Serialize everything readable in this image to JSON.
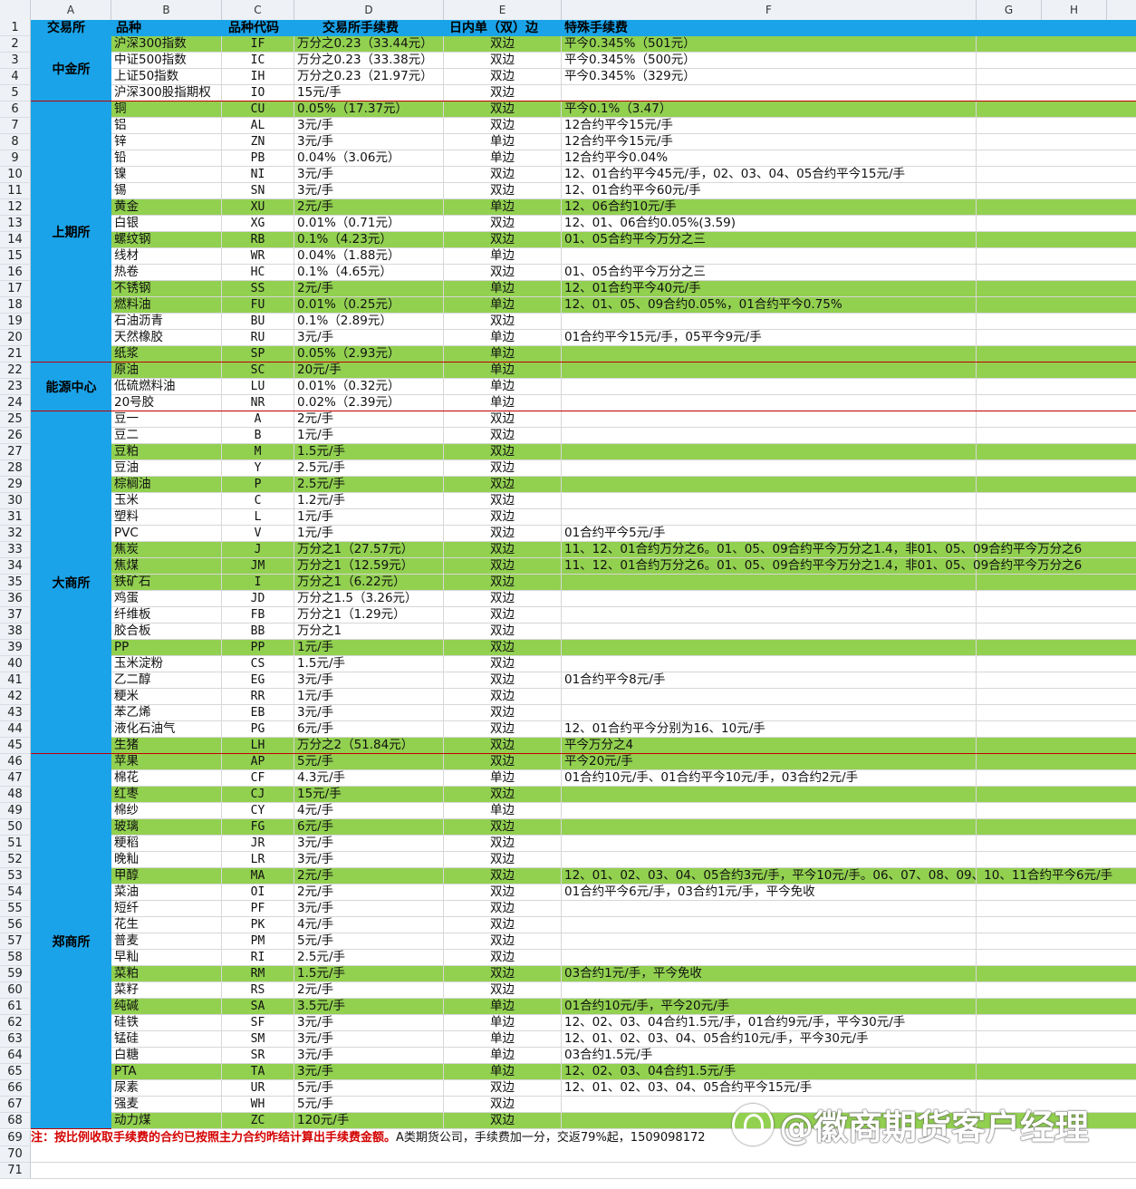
{
  "col_headers": [
    "A",
    "B",
    "C",
    "D",
    "E",
    "F",
    "G",
    "H"
  ],
  "header": {
    "exchange": "交易所",
    "variety": "品种",
    "code": "品种代码",
    "fee": "交易所手续费",
    "intraday": "日内单（双）边",
    "special": "特殊手续费"
  },
  "exchanges": [
    {
      "name": "中金所",
      "first_row": 2,
      "last_row": 5
    },
    {
      "name": "上期所",
      "first_row": 6,
      "last_row": 21
    },
    {
      "name": "能源中心",
      "first_row": 22,
      "last_row": 24
    },
    {
      "name": "大商所",
      "first_row": 25,
      "last_row": 45
    },
    {
      "name": "郑商所",
      "first_row": 46,
      "last_row": 68
    }
  ],
  "rows": [
    {
      "n": 2,
      "green": true,
      "name": "沪深300指数",
      "code": "IF",
      "fee": "万分之0.23（33.44元）",
      "side": "双边",
      "special": "平今0.345%（501元）"
    },
    {
      "n": 3,
      "green": false,
      "name": "中证500指数",
      "code": "IC",
      "fee": "万分之0.23（33.38元）",
      "side": "双边",
      "special": "平今0.345%（500元）"
    },
    {
      "n": 4,
      "green": false,
      "name": "上证50指数",
      "code": "IH",
      "fee": "万分之0.23（21.97元）",
      "side": "双边",
      "special": "平今0.345%（329元）"
    },
    {
      "n": 5,
      "green": false,
      "name": "沪深300股指期权",
      "code": "IO",
      "fee": "15元/手",
      "side": "双边",
      "special": ""
    },
    {
      "n": 6,
      "green": true,
      "name": "铜",
      "code": "CU",
      "fee": "0.05%（17.37元）",
      "side": "双边",
      "special": "平今0.1%（3.47）"
    },
    {
      "n": 7,
      "green": false,
      "name": "铝",
      "code": "AL",
      "fee": "3元/手",
      "side": "双边",
      "special": "12合约平今15元/手"
    },
    {
      "n": 8,
      "green": false,
      "name": "锌",
      "code": "ZN",
      "fee": "3元/手",
      "side": "单边",
      "special": "12合约平今15元/手"
    },
    {
      "n": 9,
      "green": false,
      "name": "铅",
      "code": "PB",
      "fee": "0.04%（3.06元）",
      "side": "单边",
      "special": "12合约平今0.04%"
    },
    {
      "n": 10,
      "green": false,
      "name": "镍",
      "code": "NI",
      "fee": "3元/手",
      "side": "双边",
      "special": "12、01合约平今45元/手，02、03、04、05合约平今15元/手"
    },
    {
      "n": 11,
      "green": false,
      "name": "锡",
      "code": "SN",
      "fee": "3元/手",
      "side": "双边",
      "special": "12、01合约平今60元/手"
    },
    {
      "n": 12,
      "green": true,
      "name": "黄金",
      "code": "XU",
      "fee": "2元/手",
      "side": "单边",
      "special": "12、06合约10元/手"
    },
    {
      "n": 13,
      "green": false,
      "name": "白银",
      "code": "XG",
      "fee": "0.01%（0.71元）",
      "side": "双边",
      "special": "12、01、06合约0.05%(3.59)"
    },
    {
      "n": 14,
      "green": true,
      "name": "螺纹钢",
      "code": "RB",
      "fee": "0.1%（4.23元）",
      "side": "双边",
      "special": "01、05合约平今万分之三"
    },
    {
      "n": 15,
      "green": false,
      "name": "线材",
      "code": "WR",
      "fee": "0.04%（1.88元）",
      "side": "单边",
      "special": ""
    },
    {
      "n": 16,
      "green": false,
      "name": "热卷",
      "code": "HC",
      "fee": "0.1%（4.65元）",
      "side": "双边",
      "special": "01、05合约平今万分之三"
    },
    {
      "n": 17,
      "green": true,
      "name": "不锈钢",
      "code": "SS",
      "fee": "2元/手",
      "side": "单边",
      "special": "12、01合约平今40元/手"
    },
    {
      "n": 18,
      "green": true,
      "name": "燃料油",
      "code": "FU",
      "fee": "0.01%（0.25元）",
      "side": "单边",
      "special": "12、01、05、09合约0.05%，01合约平今0.75%"
    },
    {
      "n": 19,
      "green": false,
      "name": "石油沥青",
      "code": "BU",
      "fee": "0.1%（2.89元）",
      "side": "双边",
      "special": ""
    },
    {
      "n": 20,
      "green": false,
      "name": "天然橡胶",
      "code": "RU",
      "fee": "3元/手",
      "side": "单边",
      "special": "01合约平今15元/手，05平今9元/手"
    },
    {
      "n": 21,
      "green": true,
      "name": "纸浆",
      "code": "SP",
      "fee": "0.05%（2.93元）",
      "side": "单边",
      "special": ""
    },
    {
      "n": 22,
      "green": true,
      "name": "原油",
      "code": "SC",
      "fee": "20元/手",
      "side": "单边",
      "special": ""
    },
    {
      "n": 23,
      "green": false,
      "name": "低硫燃料油",
      "code": "LU",
      "fee": "0.01%（0.32元）",
      "side": "单边",
      "special": ""
    },
    {
      "n": 24,
      "green": false,
      "name": "20号胶",
      "code": "NR",
      "fee": "0.02%（2.39元）",
      "side": "单边",
      "special": ""
    },
    {
      "n": 25,
      "green": false,
      "name": "豆一",
      "code": "A",
      "fee": "2元/手",
      "side": "双边",
      "special": ""
    },
    {
      "n": 26,
      "green": false,
      "name": "豆二",
      "code": "B",
      "fee": "1元/手",
      "side": "双边",
      "special": ""
    },
    {
      "n": 27,
      "green": true,
      "name": "豆粕",
      "code": "M",
      "fee": "1.5元/手",
      "side": "双边",
      "special": ""
    },
    {
      "n": 28,
      "green": false,
      "name": "豆油",
      "code": "Y",
      "fee": "2.5元/手",
      "side": "双边",
      "special": ""
    },
    {
      "n": 29,
      "green": true,
      "name": "棕榈油",
      "code": "P",
      "fee": "2.5元/手",
      "side": "双边",
      "special": ""
    },
    {
      "n": 30,
      "green": false,
      "name": "玉米",
      "code": "C",
      "fee": "1.2元/手",
      "side": "双边",
      "special": ""
    },
    {
      "n": 31,
      "green": false,
      "name": "塑料",
      "code": "L",
      "fee": "1元/手",
      "side": "双边",
      "special": ""
    },
    {
      "n": 32,
      "green": false,
      "name": "PVC",
      "code": "V",
      "fee": "1元/手",
      "side": "双边",
      "special": "01合约平今5元/手"
    },
    {
      "n": 33,
      "green": true,
      "name": "焦炭",
      "code": "J",
      "fee": "万分之1（27.57元）",
      "side": "双边",
      "special": "11、12、01合约万分之6。01、05、09合约平今万分之1.4，非01、05、09合约平今万分之6"
    },
    {
      "n": 34,
      "green": true,
      "name": "焦煤",
      "code": "JM",
      "fee": "万分之1（12.59元）",
      "side": "双边",
      "special": "11、12、01合约万分之6。01、05、09合约平今万分之1.4，非01、05、09合约平今万分之6"
    },
    {
      "n": 35,
      "green": true,
      "name": "铁矿石",
      "code": "I",
      "fee": "万分之1（6.22元）",
      "side": "双边",
      "special": ""
    },
    {
      "n": 36,
      "green": false,
      "name": "鸡蛋",
      "code": "JD",
      "fee": "万分之1.5（3.26元）",
      "side": "双边",
      "special": ""
    },
    {
      "n": 37,
      "green": false,
      "name": "纤维板",
      "code": "FB",
      "fee": "万分之1（1.29元）",
      "side": "双边",
      "special": ""
    },
    {
      "n": 38,
      "green": false,
      "name": "胶合板",
      "code": "BB",
      "fee": "万分之1",
      "side": "双边",
      "special": ""
    },
    {
      "n": 39,
      "green": true,
      "name": "PP",
      "code": "PP",
      "fee": "1元/手",
      "side": "双边",
      "special": ""
    },
    {
      "n": 40,
      "green": false,
      "name": "玉米淀粉",
      "code": "CS",
      "fee": "1.5元/手",
      "side": "双边",
      "special": ""
    },
    {
      "n": 41,
      "green": false,
      "name": "乙二醇",
      "code": "EG",
      "fee": "3元/手",
      "side": "双边",
      "special": "01合约平今8元/手"
    },
    {
      "n": 42,
      "green": false,
      "name": "粳米",
      "code": "RR",
      "fee": "1元/手",
      "side": "双边",
      "special": ""
    },
    {
      "n": 43,
      "green": false,
      "name": "苯乙烯",
      "code": "EB",
      "fee": "3元/手",
      "side": "双边",
      "special": ""
    },
    {
      "n": 44,
      "green": false,
      "name": "液化石油气",
      "code": "PG",
      "fee": "6元/手",
      "side": "双边",
      "special": "12、01合约平今分别为16、10元/手"
    },
    {
      "n": 45,
      "green": true,
      "name": "生猪",
      "code": "LH",
      "fee": "万分之2（51.84元）",
      "side": "双边",
      "special": "平今万分之4"
    },
    {
      "n": 46,
      "green": true,
      "name": "苹果",
      "code": "AP",
      "fee": "5元/手",
      "side": "双边",
      "special": "平今20元/手"
    },
    {
      "n": 47,
      "green": false,
      "name": "棉花",
      "code": "CF",
      "fee": "4.3元/手",
      "side": "单边",
      "special": "01合约10元/手、01合约平今10元/手，03合约2元/手"
    },
    {
      "n": 48,
      "green": true,
      "name": "红枣",
      "code": "CJ",
      "fee": "15元/手",
      "side": "双边",
      "special": ""
    },
    {
      "n": 49,
      "green": false,
      "name": "棉纱",
      "code": "CY",
      "fee": "4元/手",
      "side": "单边",
      "special": ""
    },
    {
      "n": 50,
      "green": true,
      "name": "玻璃",
      "code": "FG",
      "fee": "6元/手",
      "side": "双边",
      "special": ""
    },
    {
      "n": 51,
      "green": false,
      "name": "粳稻",
      "code": "JR",
      "fee": "3元/手",
      "side": "双边",
      "special": ""
    },
    {
      "n": 52,
      "green": false,
      "name": "晚籼",
      "code": "LR",
      "fee": "3元/手",
      "side": "双边",
      "special": ""
    },
    {
      "n": 53,
      "green": true,
      "name": "甲醇",
      "code": "MA",
      "fee": "2元/手",
      "side": "双边",
      "special": "12、01、02、03、04、05合约3元/手，平今10元/手。06、07、08、09、10、11合约平今6元/手"
    },
    {
      "n": 54,
      "green": false,
      "name": "菜油",
      "code": "OI",
      "fee": "2元/手",
      "side": "双边",
      "special": "01合约平今6元/手，03合约1元/手，平今免收"
    },
    {
      "n": 55,
      "green": false,
      "name": "短纤",
      "code": "PF",
      "fee": "3元/手",
      "side": "双边",
      "special": ""
    },
    {
      "n": 56,
      "green": false,
      "name": "花生",
      "code": "PK",
      "fee": "4元/手",
      "side": "双边",
      "special": ""
    },
    {
      "n": 57,
      "green": false,
      "name": "普麦",
      "code": "PM",
      "fee": "5元/手",
      "side": "双边",
      "special": ""
    },
    {
      "n": 58,
      "green": false,
      "name": "早籼",
      "code": "RI",
      "fee": "2.5元/手",
      "side": "双边",
      "special": ""
    },
    {
      "n": 59,
      "green": true,
      "name": "菜粕",
      "code": "RM",
      "fee": "1.5元/手",
      "side": "双边",
      "special": "03合约1元/手，平今免收"
    },
    {
      "n": 60,
      "green": false,
      "name": "菜籽",
      "code": "RS",
      "fee": "2元/手",
      "side": "双边",
      "special": ""
    },
    {
      "n": 61,
      "green": true,
      "name": "纯碱",
      "code": "SA",
      "fee": "3.5元/手",
      "side": "单边",
      "special": "01合约10元/手，平今20元/手"
    },
    {
      "n": 62,
      "green": false,
      "name": "硅铁",
      "code": "SF",
      "fee": "3元/手",
      "side": "单边",
      "special": "12、02、03、04合约1.5元/手，01合约9元/手，平今30元/手"
    },
    {
      "n": 63,
      "green": false,
      "name": "锰硅",
      "code": "SM",
      "fee": "3元/手",
      "side": "单边",
      "special": "12、01、02、03、04、05合约10元/手，平今30元/手"
    },
    {
      "n": 64,
      "green": false,
      "name": "白糖",
      "code": "SR",
      "fee": "3元/手",
      "side": "单边",
      "special": "03合约1.5元/手"
    },
    {
      "n": 65,
      "green": true,
      "name": "PTA",
      "code": "TA",
      "fee": "3元/手",
      "side": "单边",
      "special": "12、02、03、04合约1.5元/手"
    },
    {
      "n": 66,
      "green": false,
      "name": "尿素",
      "code": "UR",
      "fee": "5元/手",
      "side": "双边",
      "special": "12、01、02、03、04、05合约平今15元/手"
    },
    {
      "n": 67,
      "green": false,
      "name": "强麦",
      "code": "WH",
      "fee": "5元/手",
      "side": "双边",
      "special": ""
    },
    {
      "n": 68,
      "green": true,
      "name": "动力煤",
      "code": "ZC",
      "fee": "120元/手",
      "side": "双边",
      "special": ""
    }
  ],
  "note": {
    "red": "注：按比例收取手续费的合约已按照主力合约昨结计算出手续费金额。",
    "black": "A类期货公司，手续费加一分，交返79%起，1509098172"
  },
  "empty_rows": [
    70,
    71
  ],
  "watermark": "@徽商期货客户经理"
}
